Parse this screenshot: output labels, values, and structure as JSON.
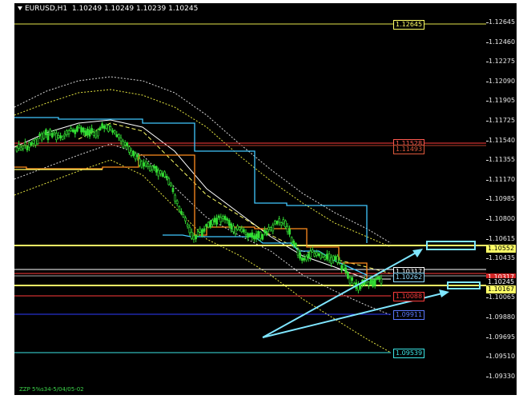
{
  "header": {
    "symbol": "EURUSD,H1",
    "ohlc": "1.10249 1.10249 1.10239 1.10245"
  },
  "footer_label": "ZZP 5%s34-5/04/05-02",
  "axis_ticks": [
    "1.12645",
    "1.12460",
    "1.12275",
    "1.12090",
    "1.11905",
    "1.11725",
    "1.11540",
    "1.11355",
    "1.11170",
    "1.10985",
    "1.10800",
    "1.10615",
    "1.10435",
    "1.10245",
    "1.10065",
    "1.09880",
    "1.09695",
    "1.09510",
    "1.09330"
  ],
  "level_labels": [
    {
      "id": "lvl-112645",
      "text": "1.12645",
      "color": "#ffff66"
    },
    {
      "id": "lvl-111528",
      "text": "1.11528",
      "color": "#ff5a50"
    },
    {
      "id": "lvl-111493",
      "text": "1.11493",
      "color": "#e05a3c"
    },
    {
      "id": "lvl-110317",
      "text": "1.10317",
      "color": "#ffffff"
    },
    {
      "id": "lvl-110262",
      "text": "1.10262",
      "color": "#8fdcff"
    },
    {
      "id": "lvl-110088",
      "text": "1.10088",
      "color": "#ff3c3c"
    },
    {
      "id": "lvl-109911",
      "text": "1.09911",
      "color": "#5a78ff"
    },
    {
      "id": "lvl-109539",
      "text": "1.09539",
      "color": "#3ce6e6"
    }
  ],
  "axis_tags": [
    {
      "id": "axtag-110552",
      "text": "1.10552",
      "bg": "#ffff66",
      "fg": "#000000"
    },
    {
      "id": "axtag-red",
      "text": "1.10317",
      "bg": "#d22323",
      "fg": "#ffffff"
    },
    {
      "id": "axtag-110245",
      "text": "1.10245",
      "bg": "#000000",
      "fg": "#ffffff"
    },
    {
      "id": "axtag-110167",
      "text": "1.10167",
      "bg": "#ffff66",
      "fg": "#000000"
    }
  ],
  "colors": {
    "background": "#000000",
    "candle": "#33dd33",
    "yellow_line": "#ffff66",
    "cyan_line": "#41c8ff",
    "orange_line": "#ff8c1e",
    "arrow": "#7fe6ff"
  }
}
